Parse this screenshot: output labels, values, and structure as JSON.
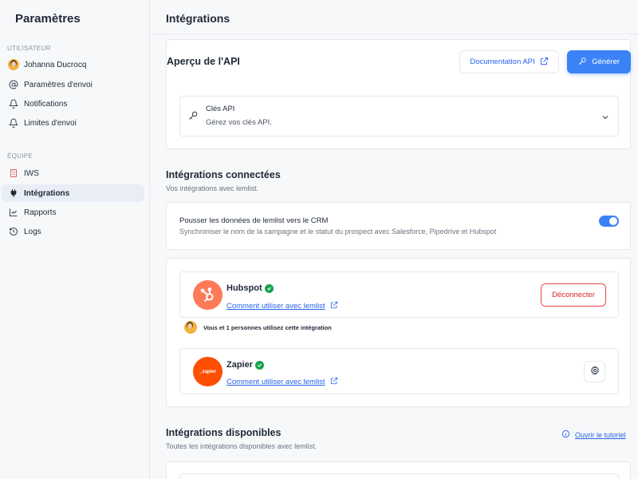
{
  "sidebar": {
    "title": "Paramètres",
    "section_user": "UTILISATEUR",
    "section_team": "ÉQUIPE",
    "user_items": [
      {
        "label": "Johanna Ducrocq",
        "icon": "avatar"
      },
      {
        "label": "Paramètres d'envoi",
        "icon": "at-icon"
      },
      {
        "label": "Notifications",
        "icon": "bell-icon"
      },
      {
        "label": "Limites d'envoi",
        "icon": "bell-icon"
      }
    ],
    "team_items": [
      {
        "label": "IWS",
        "icon": "building-icon"
      },
      {
        "label": "Intégrations",
        "icon": "plug-icon",
        "active": true
      },
      {
        "label": "Rapports",
        "icon": "chart-line-icon"
      },
      {
        "label": "Logs",
        "icon": "history-icon"
      }
    ]
  },
  "header": {
    "title": "Intégrations"
  },
  "api": {
    "title": "Aperçu de l'API",
    "doc_button": "Documentation API",
    "generate_button": "Générer",
    "keys_title": "Clés API",
    "keys_subtitle": "Gérez vos clés API."
  },
  "connected": {
    "title": "Intégrations connectées",
    "subtitle": "Vos intégrations avec lemlist.",
    "crm_title": "Pousser les données de lemlist vers le CRM",
    "crm_subtitle": "Synchroniser le nom de la campagne et le statut du prospect avec Salesforce, Pipedrive et Hubspot",
    "crm_toggle": "on",
    "hubspot": {
      "name": "Hubspot",
      "link": "Comment utiliser avec lemlist",
      "disconnect": "Déconnecter",
      "users_note": "Vous et 1 personnes utilisez cette intégration",
      "color": "#ff7a59"
    },
    "zapier": {
      "name": "Zapier",
      "link": "Comment utiliser avec lemlist",
      "logo_text": "_zapier",
      "color": "#ff4f00"
    }
  },
  "available": {
    "title": "Intégrations disponibles",
    "subtitle": "Toutes les intégrations disponibles avec lemlist.",
    "tutorial_link": "Ouvrir le tutoriel"
  },
  "colors": {
    "accent": "#3b82f6",
    "danger": "#ef4444",
    "success": "#16a34a"
  }
}
